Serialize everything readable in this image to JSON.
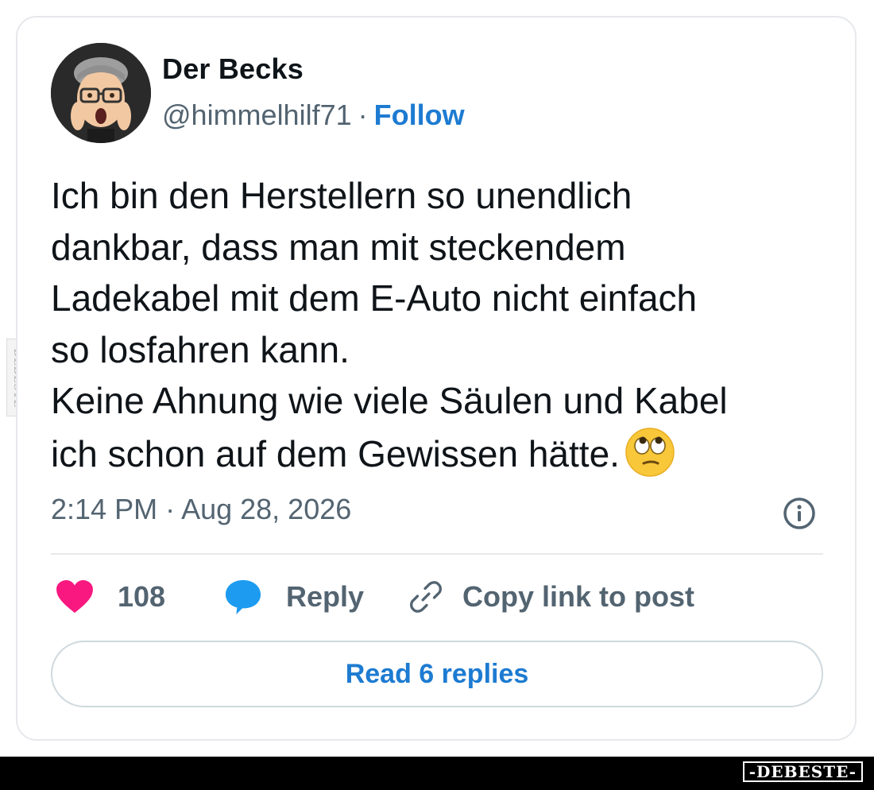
{
  "tweet": {
    "author_name": "Der Becks",
    "handle": "@himmelhilf71",
    "separator": "·",
    "follow_label": "Follow",
    "text": "Ich bin den Herstellern so unendlich\ndankbar, dass man mit steckendem\nLadekabel mit dem E-Auto nicht einfach\nso losfahren kann.\nKeine Ahnung wie viele Säulen und Kabel\nich schon auf dem Gewissen hätte.",
    "trailing_emoji": "face-with-rolling-eyes-emoji",
    "timestamp": "2:14 PM · Aug 28, 2026",
    "info_icon": "info-icon"
  },
  "actions": {
    "likes_count": "108",
    "reply_label": "Reply",
    "copy_link_label": "Copy link to post"
  },
  "read_replies_label": "Read 6 replies",
  "watermark": {
    "side_text": "DEBESTE",
    "footer_logo": "-DEBESTE-"
  },
  "colors": {
    "accent": "#1d7bd1",
    "heart": "#f91880",
    "reply_bubble": "#1d9bf0",
    "secondary_text": "#536471",
    "primary_text": "#0f1419",
    "border": "#e6e8eb"
  }
}
